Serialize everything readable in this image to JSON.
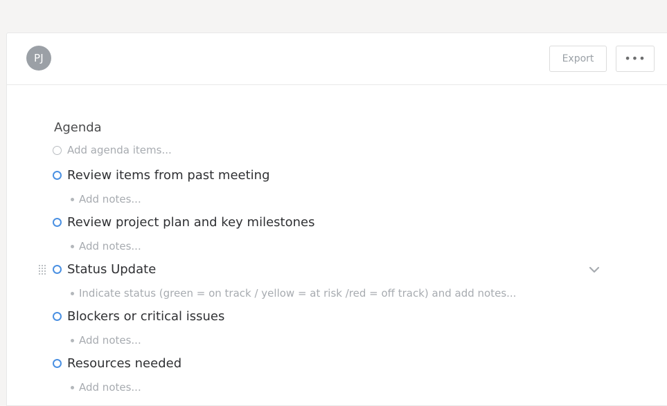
{
  "header": {
    "avatar_initials": "PJ",
    "export_label": "Export",
    "more_label": "•••"
  },
  "agenda": {
    "title": "Agenda",
    "add_placeholder": "Add agenda items...",
    "items": [
      {
        "label": "Review items from past meeting",
        "note": "Add notes..."
      },
      {
        "label": "Review project plan and key milestones",
        "note": "Add notes..."
      },
      {
        "label": "Status Update",
        "note": "Indicate status (green = on track / yellow = at risk /red = off track) and add notes..."
      },
      {
        "label": "Blockers or critical issues",
        "note": "Add notes..."
      },
      {
        "label": "Resources needed",
        "note": "Add notes..."
      }
    ]
  },
  "colors": {
    "accent": "#4a90e2",
    "background": "#f5f4f3"
  },
  "icons": {
    "drag": "drag-handle-icon",
    "chevron": "chevron-down-icon"
  }
}
